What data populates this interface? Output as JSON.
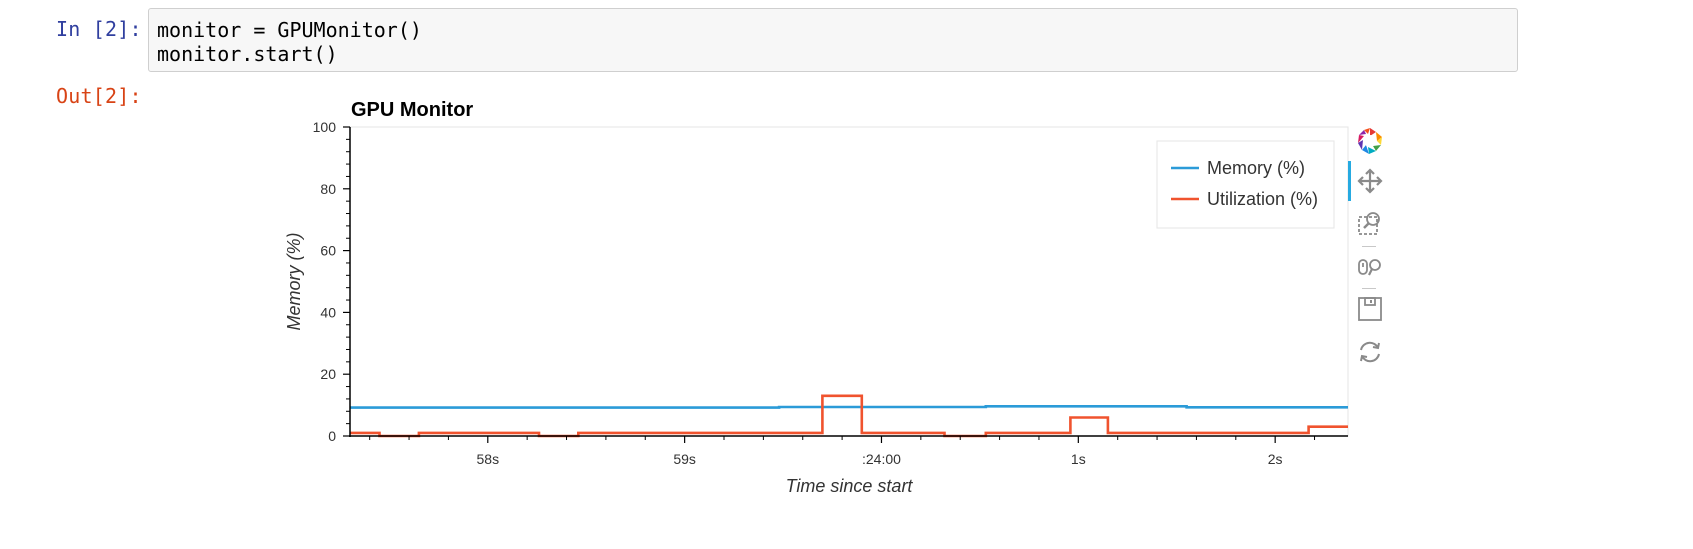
{
  "notebook": {
    "in_prompt": "In [2]:",
    "out_prompt": "Out[2]:",
    "code_lines": [
      "monitor = GPUMonitor()",
      "monitor.start()"
    ]
  },
  "toolbar": {
    "tools": [
      {
        "icon": "bokeh-logo-icon",
        "active": false
      },
      {
        "icon": "pan-icon",
        "active": true
      },
      {
        "icon": "box-zoom-icon",
        "active": false
      },
      {
        "icon": "wheel-zoom-icon",
        "active": false
      },
      {
        "icon": "save-icon",
        "active": false
      },
      {
        "icon": "reset-icon",
        "active": false
      }
    ]
  },
  "chart_data": {
    "type": "line",
    "title": "GPU Monitor",
    "xlabel": "Time since start",
    "ylabel": "Memory (%)",
    "x_unit": "seconds",
    "xlim": [
      57.3,
      62.37
    ],
    "ylim": [
      0,
      100
    ],
    "y_ticks": [
      0,
      20,
      40,
      60,
      80,
      100
    ],
    "x_ticks": [
      {
        "value": 58,
        "label": "58s"
      },
      {
        "value": 59,
        "label": "59s"
      },
      {
        "value": 60,
        "label": ":24:00"
      },
      {
        "value": 61,
        "label": "1s"
      },
      {
        "value": 62,
        "label": "2s"
      }
    ],
    "grid": false,
    "legend": "top-right",
    "series": [
      {
        "name": "Memory (%)",
        "color": "#2b9bd8",
        "x": [
          57.3,
          59.48,
          59.48,
          60.53,
          60.53,
          61.55,
          61.55,
          62.37
        ],
        "y": [
          9.2,
          9.2,
          9.4,
          9.4,
          9.6,
          9.6,
          9.3,
          9.3
        ]
      },
      {
        "name": "Utilization (%)",
        "color": "#f0532e",
        "x": [
          57.3,
          57.45,
          57.45,
          57.65,
          57.65,
          58.26,
          58.26,
          58.46,
          58.46,
          59.7,
          59.7,
          59.9,
          59.9,
          60.32,
          60.32,
          60.53,
          60.53,
          60.96,
          60.96,
          61.15,
          61.15,
          62.17,
          62.17,
          62.37
        ],
        "y": [
          1,
          1,
          0,
          0,
          1,
          1,
          0,
          0,
          1,
          1,
          13,
          13,
          1,
          1,
          0,
          0,
          1,
          1,
          6,
          6,
          1,
          1,
          3,
          3
        ]
      }
    ]
  }
}
